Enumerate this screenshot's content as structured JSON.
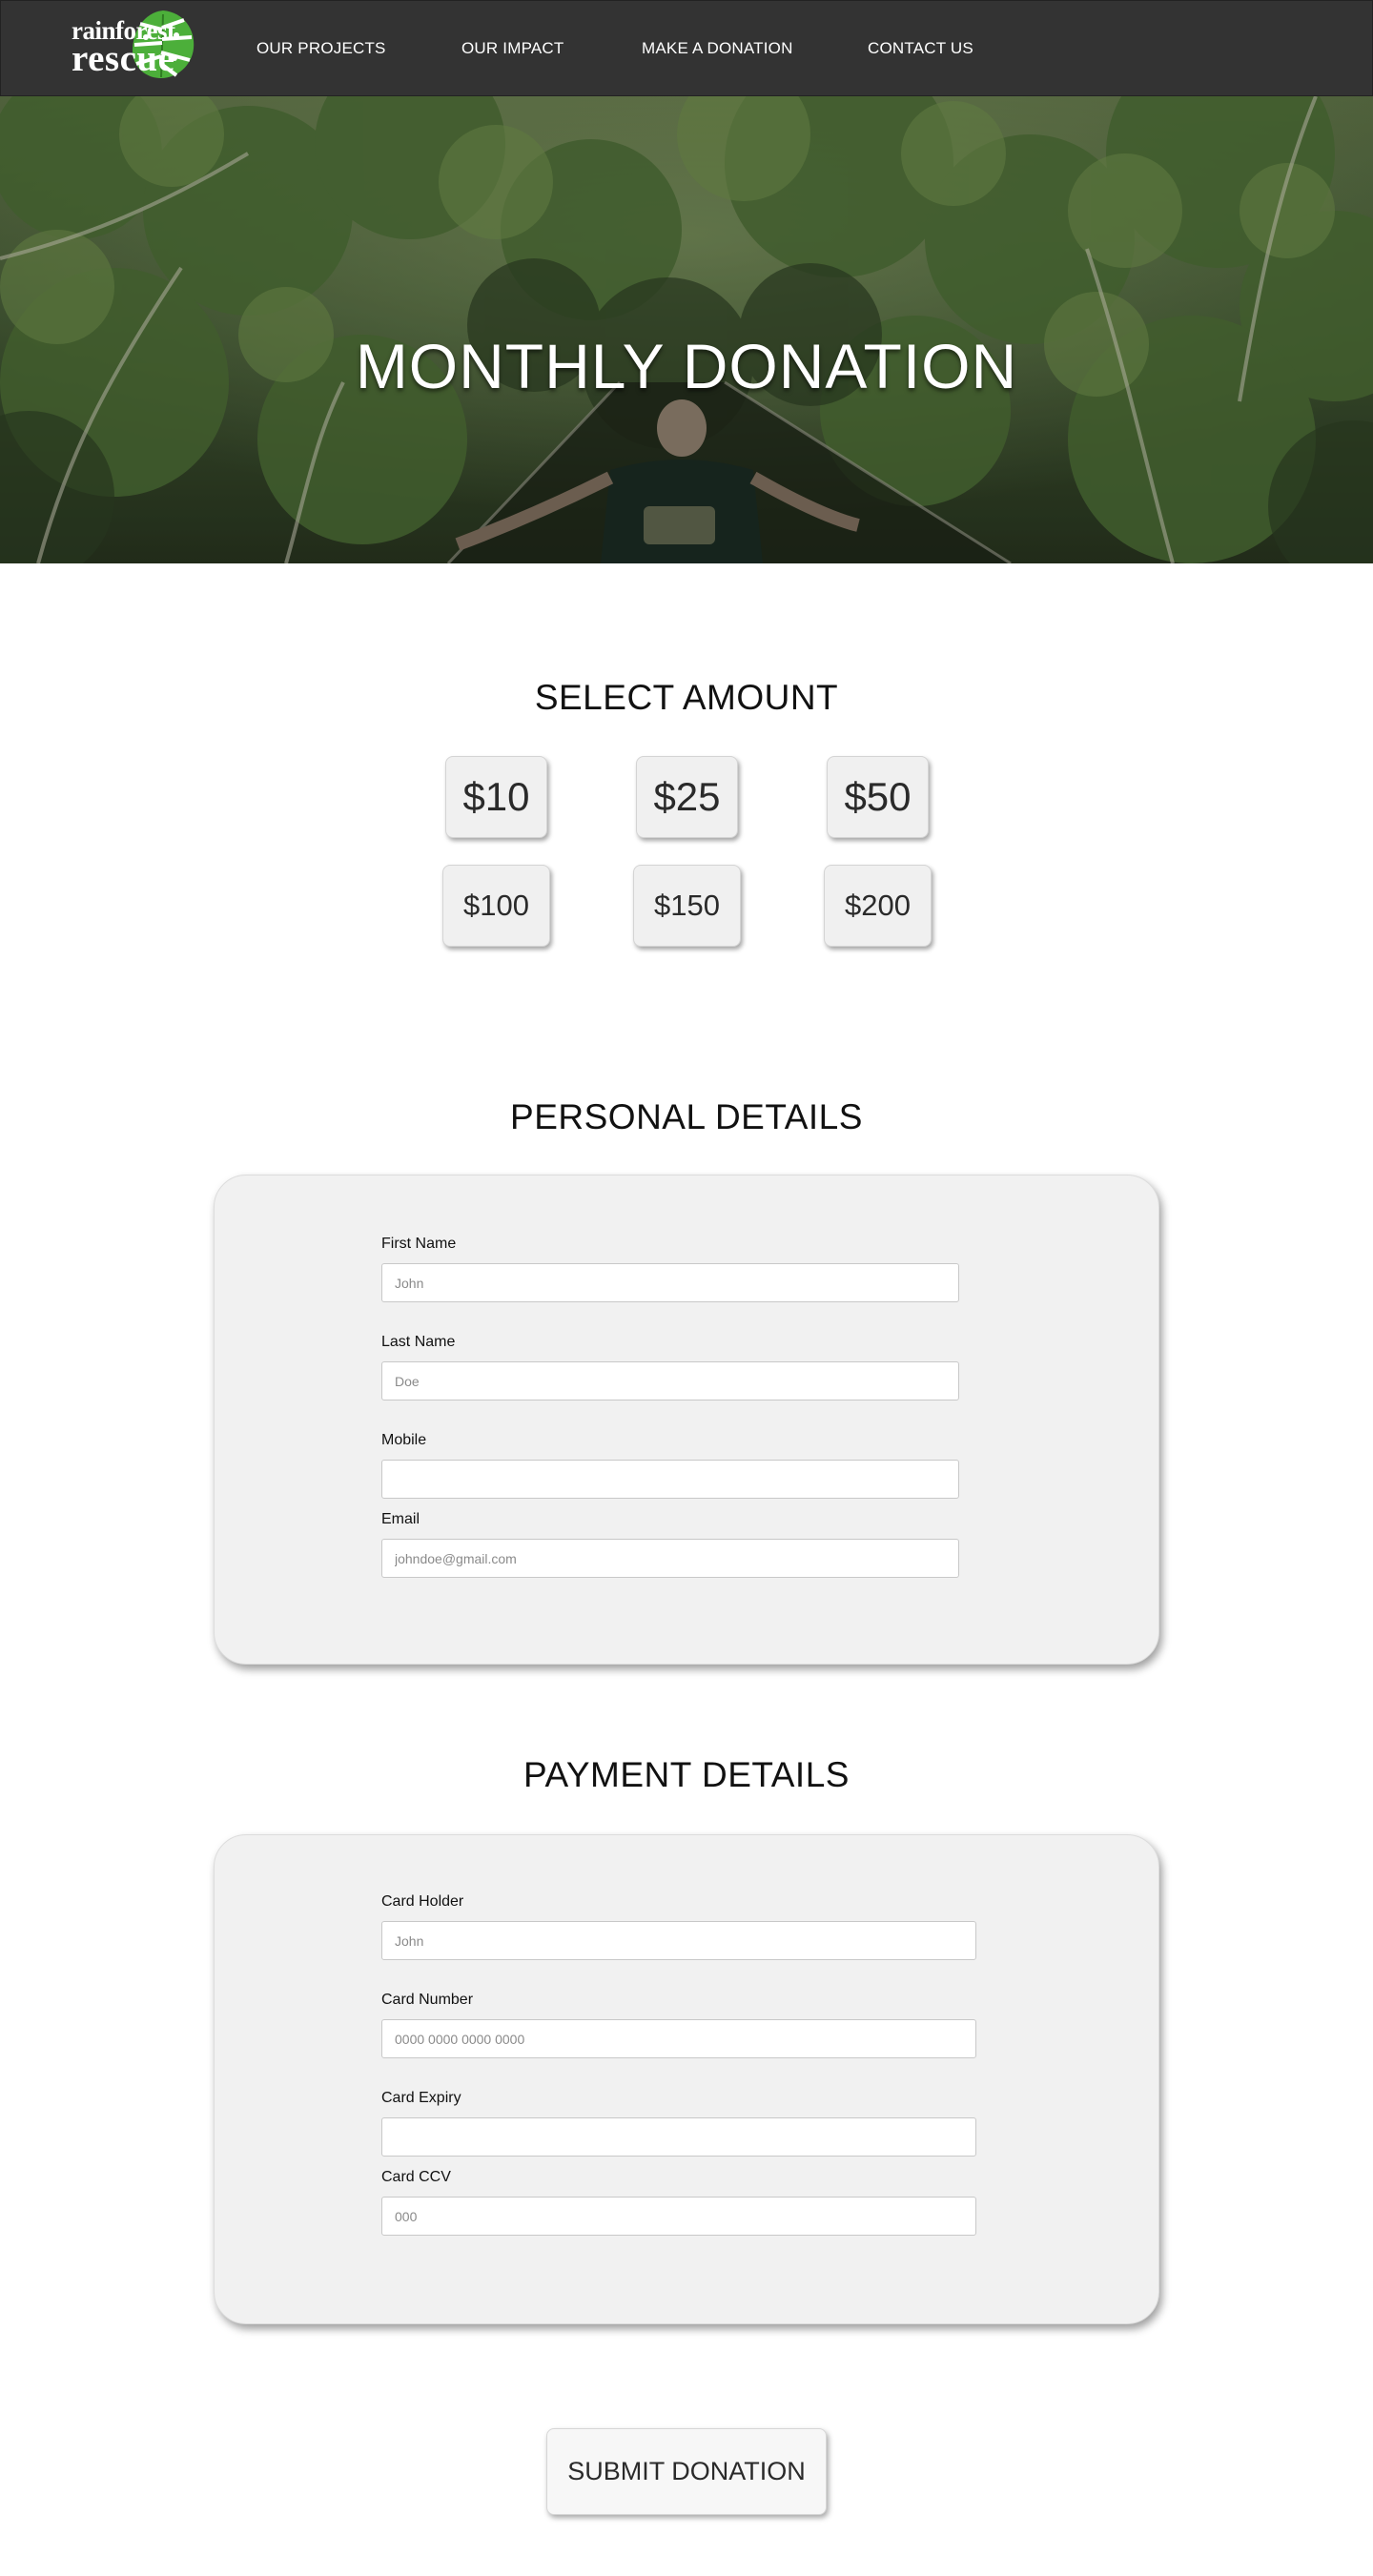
{
  "nav": {
    "logo_line1": "rainforest",
    "logo_line2": "rescue",
    "links": [
      {
        "label": "OUR PROJECTS"
      },
      {
        "label": "OUR IMPACT"
      },
      {
        "label": "MAKE A DONATION"
      },
      {
        "label": "CONTACT US"
      }
    ]
  },
  "hero": {
    "title": "MONTHLY DONATION"
  },
  "amounts": {
    "title": "SELECT AMOUNT",
    "options": [
      "$10",
      "$25",
      "$50",
      "$100",
      "$150",
      "$200"
    ]
  },
  "personal": {
    "title": "PERSONAL DETAILS",
    "fields": [
      {
        "label": "First Name",
        "placeholder": "John",
        "value": ""
      },
      {
        "label": "Last Name",
        "placeholder": "Doe",
        "value": ""
      },
      {
        "label": "Mobile",
        "placeholder": "",
        "value": ""
      },
      {
        "label": "Email",
        "placeholder": "johndoe@gmail.com",
        "value": ""
      }
    ]
  },
  "payment": {
    "title": "PAYMENT DETAILS",
    "fields": [
      {
        "label": "Card Holder",
        "placeholder": "John",
        "value": ""
      },
      {
        "label": "Card Number",
        "placeholder": "0000 0000 0000 0000",
        "value": ""
      },
      {
        "label": "Card Expiry",
        "placeholder": "",
        "value": ""
      },
      {
        "label": "Card CCV",
        "placeholder": "000",
        "value": ""
      }
    ]
  },
  "submit": {
    "label": "SUBMIT DONATION"
  },
  "colors": {
    "nav_bg": "#333333",
    "card_bg": "#f1f1f1",
    "logo_leaf": "#4caf3a"
  }
}
